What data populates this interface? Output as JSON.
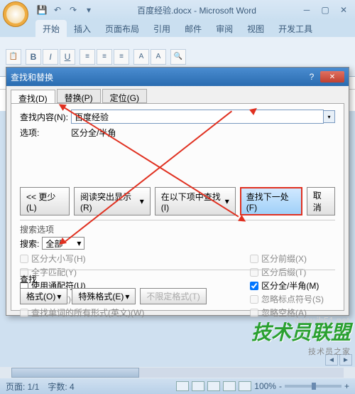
{
  "app": {
    "title": "百度经验.docx - Microsoft Word"
  },
  "ribbon": {
    "tabs": [
      "开始",
      "插入",
      "页面布局",
      "引用",
      "邮件",
      "审阅",
      "视图",
      "开发工具"
    ],
    "active": 0
  },
  "dialog": {
    "title": "查找和替换",
    "tabs": [
      {
        "label": "查找(D)"
      },
      {
        "label": "替换(P)"
      },
      {
        "label": "定位(G)"
      }
    ],
    "active_tab": 0,
    "find_label": "查找内容(N):",
    "find_value": "百度经验",
    "options_label": "选项:",
    "options_value": "区分全/半角",
    "buttons": {
      "less": "<< 更少(L)",
      "reading": "阅读突出显示(R)",
      "find_in": "在以下项中查找(I)",
      "find_next": "查找下一处(F)",
      "cancel": "取消"
    },
    "search_options_header": "搜索选项",
    "search_label": "搜索:",
    "search_direction": "全部",
    "checkboxes_left": [
      {
        "label": "区分大小写(H)",
        "checked": false,
        "enabled": false
      },
      {
        "label": "全字匹配(Y)",
        "checked": false,
        "enabled": false
      },
      {
        "label": "使用通配符(U)",
        "checked": false,
        "enabled": true
      },
      {
        "label": "同音(英文)(K)",
        "checked": false,
        "enabled": false
      },
      {
        "label": "查找单词的所有形式(英文)(W)",
        "checked": false,
        "enabled": false
      }
    ],
    "checkboxes_right": [
      {
        "label": "区分前缀(X)",
        "checked": false,
        "enabled": false
      },
      {
        "label": "区分后缀(T)",
        "checked": false,
        "enabled": false
      },
      {
        "label": "区分全/半角(M)",
        "checked": true,
        "enabled": true
      },
      {
        "label": "忽略标点符号(S)",
        "checked": false,
        "enabled": false
      },
      {
        "label": "忽略空格(A)",
        "checked": false,
        "enabled": false
      }
    ],
    "find_section": "查找",
    "format_btn": "格式(O)",
    "special_btn": "特殊格式(E)",
    "noformat_btn": "不限定格式(T)"
  },
  "status": {
    "page": "页面: 1/1",
    "words": "字数: 4",
    "lang": "",
    "zoom": "100%",
    "zoom_minus": "-",
    "zoom_plus": "+"
  },
  "watermark": {
    "main": "技术员联盟",
    "sub": "技术员之家",
    "url": "www.jb51.net"
  }
}
